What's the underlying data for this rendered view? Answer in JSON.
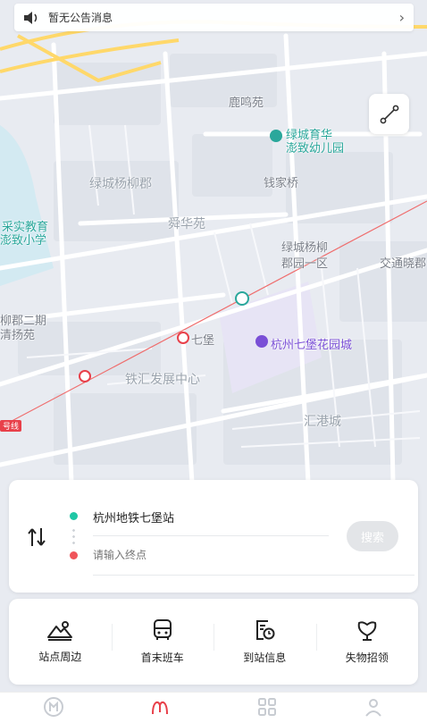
{
  "notice": {
    "icon": "speaker-icon",
    "text": "暂无公告消息",
    "arrow": "chevron-right-icon"
  },
  "map": {
    "labels": [
      {
        "key": "luming",
        "text": "鹿鸣苑",
        "style": ""
      },
      {
        "key": "kindergarten1",
        "text": "绿城育华",
        "style": "poi"
      },
      {
        "key": "kindergarten2",
        "text": "澎致幼儿园",
        "style": "poi"
      },
      {
        "key": "yangliu",
        "text": "绿城杨柳郡",
        "style": "light"
      },
      {
        "key": "qianjiaqiao",
        "text": "钱家桥",
        "style": ""
      },
      {
        "key": "school1",
        "text": "采实教育",
        "style": "poi"
      },
      {
        "key": "school2",
        "text": "澎致小学",
        "style": "poi"
      },
      {
        "key": "shunhua",
        "text": "舜华苑",
        "style": "light"
      },
      {
        "key": "yangliu1a",
        "text": "绿城杨柳",
        "style": ""
      },
      {
        "key": "yangliu1b",
        "text": "郡园一区",
        "style": ""
      },
      {
        "key": "jiaotong",
        "text": "交通晓郡",
        "style": ""
      },
      {
        "key": "yangliu2a",
        "text": "柳郡二期",
        "style": ""
      },
      {
        "key": "yangliu2b",
        "text": "清扬苑",
        "style": ""
      },
      {
        "key": "qibao",
        "text": "七堡",
        "style": ""
      },
      {
        "key": "garden",
        "text": "杭州七堡花园城",
        "style": "purple"
      },
      {
        "key": "tiehui",
        "text": "铁汇发展中心",
        "style": "light"
      },
      {
        "key": "huigang",
        "text": "汇港城",
        "style": "light"
      },
      {
        "key": "line1",
        "text": "号线",
        "style": "red"
      }
    ]
  },
  "search": {
    "from": "杭州地铁七堡站",
    "to_placeholder": "请输入终点",
    "button": "搜索"
  },
  "quick": [
    {
      "name": "nearby",
      "icon": "station-nearby-icon",
      "label": "站点周边"
    },
    {
      "name": "schedule",
      "icon": "bus-icon",
      "label": "首末班车"
    },
    {
      "name": "arrival",
      "icon": "arrival-clock-icon",
      "label": "到站信息"
    },
    {
      "name": "lostfound",
      "icon": "lost-found-icon",
      "label": "失物招领"
    }
  ],
  "tabs": [
    {
      "name": "home",
      "icon": "metro-logo-icon"
    },
    {
      "name": "route",
      "icon": "route-icon"
    },
    {
      "name": "apps",
      "icon": "apps-grid-icon"
    },
    {
      "name": "profile",
      "icon": "profile-icon"
    }
  ],
  "colors": {
    "accent": "#1fc7a5",
    "destination": "#f0545a",
    "metro": "#e8404a"
  }
}
